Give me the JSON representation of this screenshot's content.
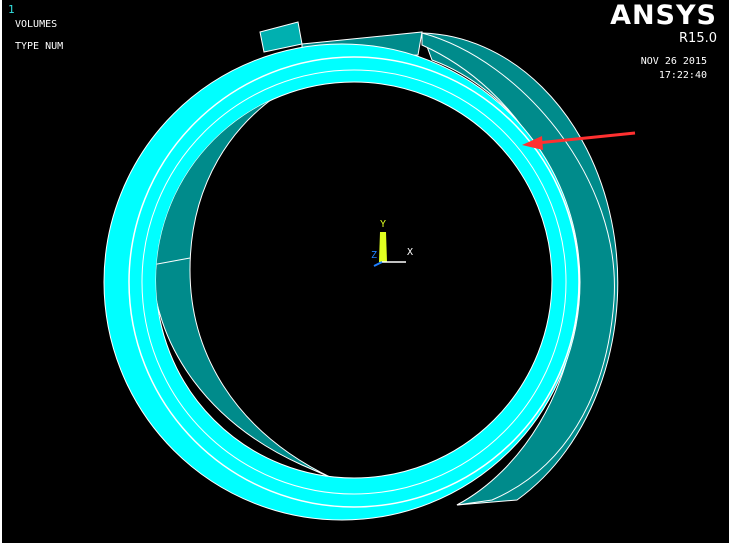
{
  "viewport": {
    "window_number": "1",
    "entity_label": "VOLUMES",
    "numbering_label": "TYPE NUM"
  },
  "branding": {
    "product": "ANSYS",
    "version": "R15.0"
  },
  "timestamp": {
    "date": "NOV 26 2015",
    "time": "17:22:40"
  },
  "triad": {
    "x_label": "X",
    "y_label": "Y",
    "z_label": "Z"
  },
  "colors": {
    "background": "#000000",
    "face_light": "#00ffff",
    "face_dark": "#008b8b",
    "edge": "#ffffff",
    "arrow": "#ff3030",
    "triad_y": "#e0ff20",
    "triad_z": "#2080ff"
  }
}
